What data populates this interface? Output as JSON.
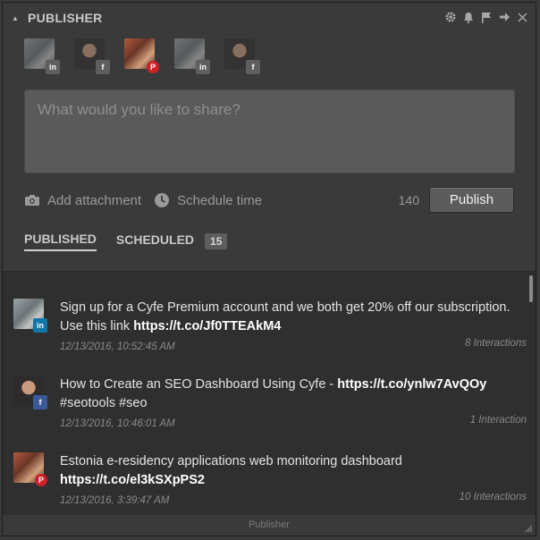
{
  "header": {
    "title": "PUBLISHER"
  },
  "header_icons": [
    "gear-icon",
    "bell-icon",
    "flag-icon",
    "arrow-right-icon",
    "close-icon"
  ],
  "accounts": [
    {
      "network": "linkedin",
      "badge": "in",
      "avatar": "cat",
      "selected": false
    },
    {
      "network": "facebook",
      "badge": "f",
      "avatar": "man",
      "selected": false
    },
    {
      "network": "pinterest",
      "badge": "P",
      "avatar": "art",
      "selected": true
    },
    {
      "network": "linkedin",
      "badge": "in",
      "avatar": "cat",
      "selected": false
    },
    {
      "network": "facebook",
      "badge": "f",
      "avatar": "man",
      "selected": false
    }
  ],
  "composer": {
    "placeholder": "What would you like to share?"
  },
  "actions": {
    "attachment_label": "Add attachment",
    "schedule_label": "Schedule time",
    "char_count": "140",
    "publish_label": "Publish"
  },
  "tabs": {
    "published_label": "PUBLISHED",
    "scheduled_label": "SCHEDULED",
    "scheduled_count": "15"
  },
  "posts": [
    {
      "text": "Sign up for a Cyfe Premium account and we both get 20% off our subscription. Use this link ",
      "link": "https://t.co/Jf0TTEAkM4",
      "tail": "",
      "date": "12/13/2016, 10:52:45 AM",
      "interactions": "8 Interactions",
      "network": "linkedin",
      "badge": "in"
    },
    {
      "text": "How to Create an SEO Dashboard Using Cyfe - ",
      "link": "https://t.co/ynlw7AvQOy",
      "tail": " #seotools #seo",
      "date": "12/13/2016, 10:46:01 AM",
      "interactions": "1 Interaction",
      "network": "facebook",
      "badge": "f"
    },
    {
      "text": "Estonia e-residency applications web monitoring dashboard ",
      "link": "https://t.co/el3kSXpPS2",
      "tail": "",
      "date": "12/13/2016, 3:39:47 AM",
      "interactions": "10 Interactions",
      "network": "pinterest",
      "badge": "P"
    }
  ],
  "footer": {
    "label": "Publisher"
  },
  "colors": {
    "background": "#3a3a3a",
    "feed_background": "#2f2f2f",
    "pinterest": "#cc2127"
  }
}
